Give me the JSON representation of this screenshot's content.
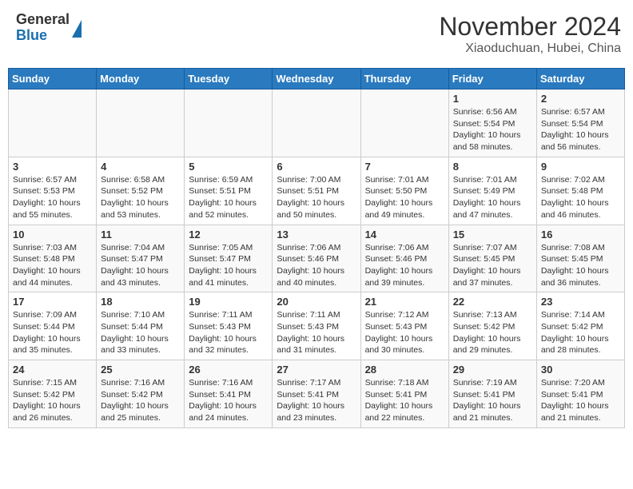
{
  "header": {
    "logo_general": "General",
    "logo_blue": "Blue",
    "month_title": "November 2024",
    "subtitle": "Xiaoduchuan, Hubei, China"
  },
  "weekdays": [
    "Sunday",
    "Monday",
    "Tuesday",
    "Wednesday",
    "Thursday",
    "Friday",
    "Saturday"
  ],
  "weeks": [
    [
      {
        "day": "",
        "info": ""
      },
      {
        "day": "",
        "info": ""
      },
      {
        "day": "",
        "info": ""
      },
      {
        "day": "",
        "info": ""
      },
      {
        "day": "",
        "info": ""
      },
      {
        "day": "1",
        "info": "Sunrise: 6:56 AM\nSunset: 5:54 PM\nDaylight: 10 hours and 58 minutes."
      },
      {
        "day": "2",
        "info": "Sunrise: 6:57 AM\nSunset: 5:54 PM\nDaylight: 10 hours and 56 minutes."
      }
    ],
    [
      {
        "day": "3",
        "info": "Sunrise: 6:57 AM\nSunset: 5:53 PM\nDaylight: 10 hours and 55 minutes."
      },
      {
        "day": "4",
        "info": "Sunrise: 6:58 AM\nSunset: 5:52 PM\nDaylight: 10 hours and 53 minutes."
      },
      {
        "day": "5",
        "info": "Sunrise: 6:59 AM\nSunset: 5:51 PM\nDaylight: 10 hours and 52 minutes."
      },
      {
        "day": "6",
        "info": "Sunrise: 7:00 AM\nSunset: 5:51 PM\nDaylight: 10 hours and 50 minutes."
      },
      {
        "day": "7",
        "info": "Sunrise: 7:01 AM\nSunset: 5:50 PM\nDaylight: 10 hours and 49 minutes."
      },
      {
        "day": "8",
        "info": "Sunrise: 7:01 AM\nSunset: 5:49 PM\nDaylight: 10 hours and 47 minutes."
      },
      {
        "day": "9",
        "info": "Sunrise: 7:02 AM\nSunset: 5:48 PM\nDaylight: 10 hours and 46 minutes."
      }
    ],
    [
      {
        "day": "10",
        "info": "Sunrise: 7:03 AM\nSunset: 5:48 PM\nDaylight: 10 hours and 44 minutes."
      },
      {
        "day": "11",
        "info": "Sunrise: 7:04 AM\nSunset: 5:47 PM\nDaylight: 10 hours and 43 minutes."
      },
      {
        "day": "12",
        "info": "Sunrise: 7:05 AM\nSunset: 5:47 PM\nDaylight: 10 hours and 41 minutes."
      },
      {
        "day": "13",
        "info": "Sunrise: 7:06 AM\nSunset: 5:46 PM\nDaylight: 10 hours and 40 minutes."
      },
      {
        "day": "14",
        "info": "Sunrise: 7:06 AM\nSunset: 5:46 PM\nDaylight: 10 hours and 39 minutes."
      },
      {
        "day": "15",
        "info": "Sunrise: 7:07 AM\nSunset: 5:45 PM\nDaylight: 10 hours and 37 minutes."
      },
      {
        "day": "16",
        "info": "Sunrise: 7:08 AM\nSunset: 5:45 PM\nDaylight: 10 hours and 36 minutes."
      }
    ],
    [
      {
        "day": "17",
        "info": "Sunrise: 7:09 AM\nSunset: 5:44 PM\nDaylight: 10 hours and 35 minutes."
      },
      {
        "day": "18",
        "info": "Sunrise: 7:10 AM\nSunset: 5:44 PM\nDaylight: 10 hours and 33 minutes."
      },
      {
        "day": "19",
        "info": "Sunrise: 7:11 AM\nSunset: 5:43 PM\nDaylight: 10 hours and 32 minutes."
      },
      {
        "day": "20",
        "info": "Sunrise: 7:11 AM\nSunset: 5:43 PM\nDaylight: 10 hours and 31 minutes."
      },
      {
        "day": "21",
        "info": "Sunrise: 7:12 AM\nSunset: 5:43 PM\nDaylight: 10 hours and 30 minutes."
      },
      {
        "day": "22",
        "info": "Sunrise: 7:13 AM\nSunset: 5:42 PM\nDaylight: 10 hours and 29 minutes."
      },
      {
        "day": "23",
        "info": "Sunrise: 7:14 AM\nSunset: 5:42 PM\nDaylight: 10 hours and 28 minutes."
      }
    ],
    [
      {
        "day": "24",
        "info": "Sunrise: 7:15 AM\nSunset: 5:42 PM\nDaylight: 10 hours and 26 minutes."
      },
      {
        "day": "25",
        "info": "Sunrise: 7:16 AM\nSunset: 5:42 PM\nDaylight: 10 hours and 25 minutes."
      },
      {
        "day": "26",
        "info": "Sunrise: 7:16 AM\nSunset: 5:41 PM\nDaylight: 10 hours and 24 minutes."
      },
      {
        "day": "27",
        "info": "Sunrise: 7:17 AM\nSunset: 5:41 PM\nDaylight: 10 hours and 23 minutes."
      },
      {
        "day": "28",
        "info": "Sunrise: 7:18 AM\nSunset: 5:41 PM\nDaylight: 10 hours and 22 minutes."
      },
      {
        "day": "29",
        "info": "Sunrise: 7:19 AM\nSunset: 5:41 PM\nDaylight: 10 hours and 21 minutes."
      },
      {
        "day": "30",
        "info": "Sunrise: 7:20 AM\nSunset: 5:41 PM\nDaylight: 10 hours and 21 minutes."
      }
    ]
  ]
}
